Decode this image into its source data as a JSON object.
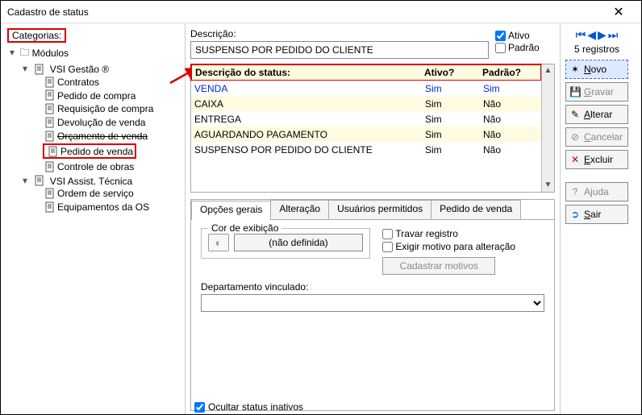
{
  "window": {
    "title": "Cadastro de status"
  },
  "left": {
    "categorias_label": "Categorias:",
    "modulos": "Módulos",
    "gestao": "VSI Gestão ®",
    "gestao_items": [
      "Contratos",
      "Pedido de compra",
      "Requisição de compra",
      "Devolução de venda",
      "Orçamento de venda",
      "Pedido de venda",
      "Controle de obras"
    ],
    "assist": "VSI Assist. Técnica",
    "assist_items": [
      "Ordem de serviço",
      "Equipamentos da OS"
    ]
  },
  "desc": {
    "label": "Descrição:",
    "value": "SUSPENSO POR PEDIDO DO CLIENTE",
    "ativo": "Ativo",
    "padrao": "Padrão"
  },
  "grid": {
    "h1": "Descrição do status:",
    "h2": "Ativo?",
    "h3": "Padrão?",
    "rows": [
      {
        "d": "VENDA",
        "a": "Sim",
        "p": "Sim"
      },
      {
        "d": "CAIXA",
        "a": "Sim",
        "p": "Não"
      },
      {
        "d": "ENTREGA",
        "a": "Sim",
        "p": "Não"
      },
      {
        "d": "AGUARDANDO PAGAMENTO",
        "a": "Sim",
        "p": "Não"
      },
      {
        "d": "SUSPENSO POR PEDIDO DO CLIENTE",
        "a": "Sim",
        "p": "Não"
      }
    ]
  },
  "tabs": {
    "t1": "Opções gerais",
    "t2": "Alteração",
    "t3": "Usuários permitidos",
    "t4": "Pedido de venda",
    "cor_legend": "Cor de exibição",
    "cor_btn": "(não definida)",
    "travar": "Travar registro",
    "exigir": "Exigir motivo para alteração",
    "cadmot": "Cadastrar motivos",
    "dep_label": "Departamento vinculado:"
  },
  "bottom": {
    "ocultar": "Ocultar status inativos"
  },
  "right": {
    "registros": "5 registros",
    "novo": "Novo",
    "gravar": "Gravar",
    "alterar": "Alterar",
    "cancelar": "Cancelar",
    "excluir": "Excluir",
    "ajuda": "Ajuda",
    "sair": "Sair"
  }
}
